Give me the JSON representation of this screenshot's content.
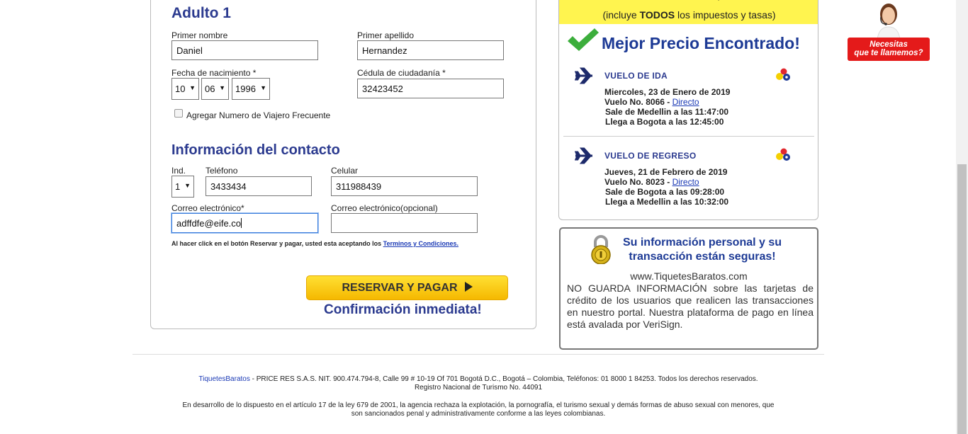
{
  "passenger": {
    "heading": "Adulto 1",
    "first_name_label": "Primer nombre",
    "first_name_value": "Daniel",
    "last_name_label": "Primer apellido",
    "last_name_value": "Hernandez",
    "birth_label": "Fecha de nacimiento *",
    "birth_day": "10",
    "birth_month": "06",
    "birth_year": "1996",
    "id_label": "Cédula de ciudadanía *",
    "id_value": "32423452",
    "frequent_flyer_label": "Agregar Numero de Viajero Frecuente"
  },
  "contact": {
    "heading": "Información del contacto",
    "ind_label": "Ind.",
    "ind_value": "1",
    "phone_label": "Teléfono",
    "phone_value": "3433434",
    "mobile_label": "Celular",
    "mobile_value": "311988439",
    "email_label": "Correo electrónico*",
    "email_value": "adffdfe@eife.co",
    "email2_label": "Correo electrónico(opcional)",
    "email2_value": ""
  },
  "legal": {
    "text": "Al hacer click en el botón Reservar y pagar, usted esta aceptando los ",
    "link": "Terminos y Condiciones."
  },
  "actions": {
    "pay_label": "RESERVAR Y PAGAR",
    "confirm_text": "Confirmación inmediata!"
  },
  "summary": {
    "tax_prefix": "(incluye ",
    "tax_bold": "TODOS",
    "tax_suffix": " los impuestos y tasas)",
    "best_price": "Mejor Precio Encontrado!",
    "outbound": {
      "title": "VUELO DE IDA",
      "date": "Miercoles, 23 de Enero de 2019",
      "flight_prefix": "Vuelo No. 8066 - ",
      "flight_link": "Directo",
      "depart": "Sale de Medellin a las 11:47:00",
      "arrive": "Llega a Bogota a las 12:45:00"
    },
    "return": {
      "title": "VUELO DE REGRESO",
      "date": "Jueves, 21 de Febrero de 2019",
      "flight_prefix": "Vuelo No. 8023 - ",
      "flight_link": "Directo",
      "depart": "Sale de Bogota a las 09:28:00",
      "arrive": "Llega a Medellin a las 10:32:00"
    }
  },
  "security": {
    "title": "Su información personal y su transacción están seguras!",
    "site": "www.TiquetesBaratos.com",
    "body": "NO GUARDA INFORMACIÓN sobre las tarjetas de crédito de los usuarios que realicen las transacciones en nuestro portal. Nuestra plataforma de pago en línea está avalada por VeriSign."
  },
  "callback": {
    "line1": "Necesitas",
    "line2": "que te llamemos?"
  },
  "footer": {
    "brand": "TiquetesBaratos",
    "line1": " - PRICE RES S.A.S. NIT. 900.474.794-8, Calle 99 # 10-19 Of 701 Bogotá D.C., Bogotá – Colombia, Teléfonos: 01 8000 1 84253. Todos los derechos reservados.",
    "line2": "Registro Nacional de Turismo No. 44091",
    "line3": "En desarrollo de lo dispuesto en el artículo 17 de la ley 679 de 2001, la agencia rechaza la explotación, la pornografía, el turismo sexual y demás formas de abuso sexual con menores, que",
    "line4": "son sancionados penal y administrativamente conforme a las leyes colombianas."
  },
  "colors": {
    "brand_blue": "#2b3a8f",
    "price_yellow": "#fff44f",
    "button_yellow": "#f5b800",
    "callback_red": "#e41a1a",
    "check_green": "#3cae3c"
  }
}
